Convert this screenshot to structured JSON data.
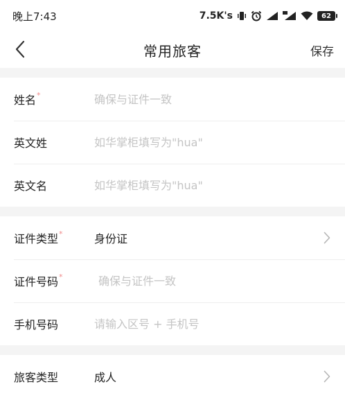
{
  "status_bar": {
    "time": "晚上7:43",
    "network_speed": "7.5K's",
    "battery_level": "62"
  },
  "nav": {
    "title": "常用旅客",
    "save_label": "保存"
  },
  "sections": [
    {
      "fields": [
        {
          "label": "姓名",
          "required": true,
          "placeholder": "确保与证件一致"
        },
        {
          "label": "英文姓",
          "required": false,
          "placeholder": "如华掌柜填写为\"hua\""
        },
        {
          "label": "英文名",
          "required": false,
          "placeholder": "如华掌柜填写为\"hua\""
        }
      ]
    },
    {
      "fields": [
        {
          "label": "证件类型",
          "required": true,
          "value": "身份证"
        },
        {
          "label": "证件号码",
          "required": true,
          "placeholder": "确保与证件一致"
        },
        {
          "label": "手机号码",
          "required": false,
          "placeholder": "请输入区号 + 手机号"
        }
      ]
    },
    {
      "fields": [
        {
          "label": "旅客类型",
          "required": false,
          "value": "成人"
        }
      ]
    }
  ],
  "required_marker": "*",
  "icons": {
    "back": "chevron-left-icon",
    "row_arrow": "chevron-right-icon"
  },
  "colors": {
    "section_gap": "#f4f4f4",
    "placeholder": "#c4c4c4",
    "required_marker": "#f08a8a"
  }
}
